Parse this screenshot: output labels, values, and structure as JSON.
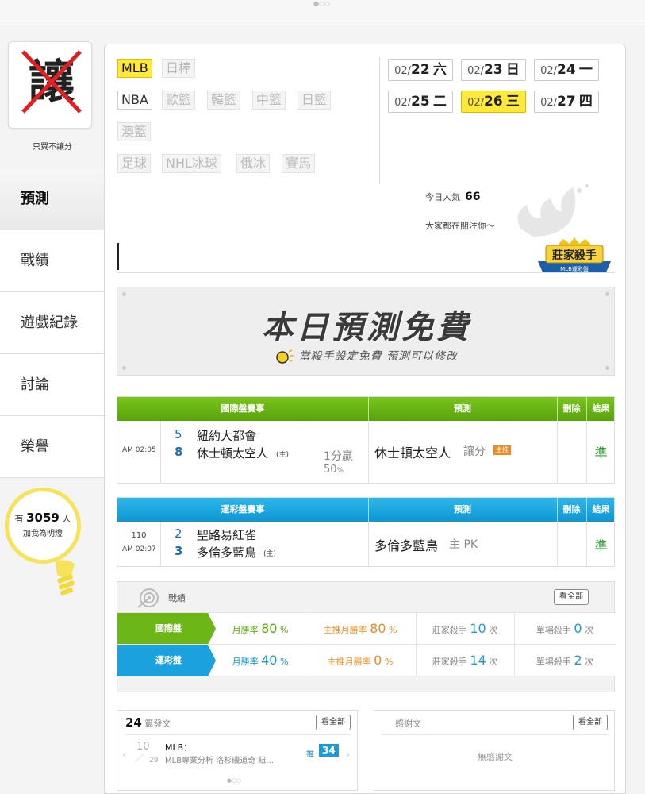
{
  "sidebar": {
    "badge_char": "讓",
    "badge_caption": "只買不讓分",
    "nav": [
      "預測",
      "戰績",
      "遊戲紀錄",
      "討論",
      "榮譽"
    ],
    "fans_prefix": "有",
    "fans_count": "3059",
    "fans_suffix": "人",
    "fans_caption": "加我為明燈"
  },
  "leagues": {
    "row1": [
      "MLB",
      "日棒"
    ],
    "row2": [
      "NBA",
      "歐籃",
      "韓籃",
      "中籃",
      "日籃"
    ],
    "row3": [
      "澳籃"
    ],
    "row4": [
      "足球",
      "NHL冰球",
      "俄冰",
      "賽馬"
    ],
    "selected": "MLB"
  },
  "dates": [
    {
      "md": "02/",
      "d": "22",
      "w": "六"
    },
    {
      "md": "02/",
      "d": "23",
      "w": "日"
    },
    {
      "md": "02/",
      "d": "24",
      "w": "一"
    },
    {
      "md": "02/",
      "d": "25",
      "w": "二"
    },
    {
      "md": "02/",
      "d": "26",
      "w": "三"
    },
    {
      "md": "02/",
      "d": "27",
      "w": "四"
    }
  ],
  "popularity": {
    "label": "今日人氣",
    "value": "66",
    "note": "大家都在關注你～"
  },
  "logo": {
    "title": "莊家殺手",
    "sub": "MLB運彩盤"
  },
  "banner": {
    "title": "本日預測免費",
    "sub": "當殺手設定免費 預測可以修改"
  },
  "intl_table": {
    "headers": [
      "國際盤賽事",
      "預測",
      "刪除",
      "結果"
    ],
    "time": "AM 02:05",
    "team1_no": "5",
    "team1": "紐約大都會",
    "team2_no": "8",
    "team2": "休士頓太空人",
    "home_mark": "(主)",
    "line": "1分贏",
    "pct": "50",
    "pct_unit": "%",
    "pick": "休士頓太空人",
    "pick_type": "讓分",
    "pick_tag": "主推",
    "result": "準"
  },
  "lottery_table": {
    "headers": [
      "運彩盤賽事",
      "預測",
      "刪除",
      "結果"
    ],
    "game_no": "110",
    "time": "AM 02:07",
    "team1_no": "2",
    "team1": "聖路易紅雀",
    "team2_no": "3",
    "team2": "多倫多藍鳥",
    "home_mark": "(主)",
    "pick": "多倫多藍鳥",
    "pick_suffix": "主 PK",
    "result": "準"
  },
  "record": {
    "title": "戰績",
    "view_all": "看全部",
    "rows": [
      {
        "label": "國際盤",
        "month_label": "月勝率",
        "month_val": "80",
        "main_label": "主推月勝率",
        "main_val": "80",
        "kill_label": "莊家殺手",
        "kill_val": "10",
        "kill_unit": "次",
        "single_label": "單場殺手",
        "single_val": "0",
        "single_unit": "次",
        "pct": "%"
      },
      {
        "label": "運彩盤",
        "month_label": "月勝率",
        "month_val": "40",
        "main_label": "主推月勝率",
        "main_val": "0",
        "kill_label": "莊家殺手",
        "kill_val": "14",
        "kill_unit": "次",
        "single_label": "單場殺手",
        "single_val": "2",
        "single_unit": "次",
        "pct": "%"
      }
    ]
  },
  "posts": {
    "count": "24",
    "count_label": "篇發文",
    "view_all": "看全部",
    "date_top": "10",
    "date_bottom": "29",
    "item_title": "MLB：",
    "item_desc": "MLB專業分析 洛杉磯道奇 紐...",
    "push_label": "推",
    "push_count": "34"
  },
  "thanks": {
    "title": "感謝文",
    "view_all": "看全部",
    "empty": "無感謝文"
  },
  "colors": {
    "highlight": "#ffe93a",
    "green": "#5aa50c",
    "blue": "#0e98d6",
    "orange": "#f08a1c",
    "accent_num": "#1a9ad6"
  }
}
